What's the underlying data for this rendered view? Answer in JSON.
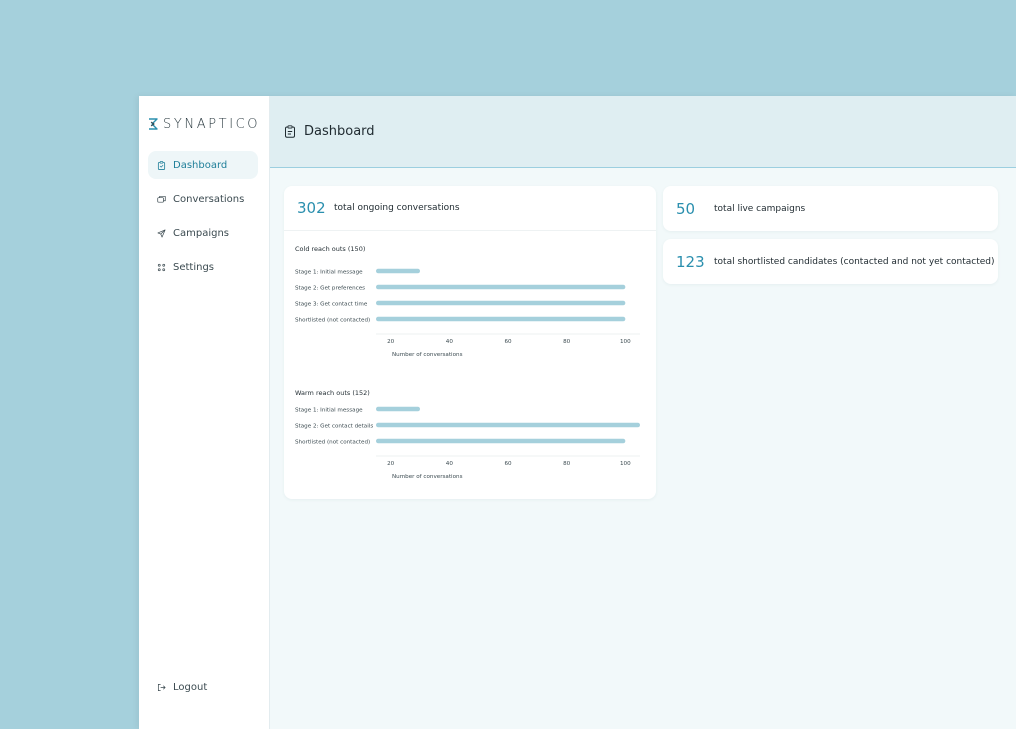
{
  "brand": {
    "name": "SYNAPTICO"
  },
  "sidebar": {
    "items": [
      {
        "label": "Dashboard",
        "icon": "clipboard-icon",
        "active": true
      },
      {
        "label": "Conversations",
        "icon": "chat-bubbles-icon",
        "active": false
      },
      {
        "label": "Campaigns",
        "icon": "send-icon",
        "active": false
      },
      {
        "label": "Settings",
        "icon": "grid-dots-icon",
        "active": false
      }
    ],
    "logout": {
      "label": "Logout",
      "icon": "logout-icon"
    }
  },
  "header": {
    "title": "Dashboard",
    "icon": "clipboard-icon"
  },
  "stats": {
    "ongoing": {
      "value": "302",
      "label": "total ongoing conversations"
    },
    "live": {
      "value": "50",
      "label": "total live campaigns"
    },
    "shortlisted": {
      "value": "123",
      "label": "total shortlisted candidates (contacted and not yet contacted)"
    }
  },
  "colors": {
    "accent": "#2a8fae",
    "bar": "#a5d0dc",
    "background": "#a5d0dc"
  },
  "chart_data": [
    {
      "type": "bar",
      "orientation": "horizontal",
      "title": "Cold reach outs (150)",
      "categories": [
        "Stage 1: Initial message",
        "Stage 2: Get preferences",
        "Stage 3: Get contact time",
        "Shortlisted (not contacted)"
      ],
      "values": [
        30,
        100,
        100,
        100
      ],
      "xlabel": "Number of conversations",
      "xticks": [
        20,
        40,
        60,
        80,
        100
      ],
      "xlim": [
        15,
        105
      ]
    },
    {
      "type": "bar",
      "orientation": "horizontal",
      "title": "Warm reach outs (152)",
      "categories": [
        "Stage 1: Initial message",
        "Stage 2: Get contact details",
        "Shortlisted (not contacted)"
      ],
      "values": [
        30,
        105,
        100
      ],
      "xlabel": "Number of conversations",
      "xticks": [
        20,
        40,
        60,
        80,
        100
      ],
      "xlim": [
        15,
        105
      ]
    }
  ]
}
